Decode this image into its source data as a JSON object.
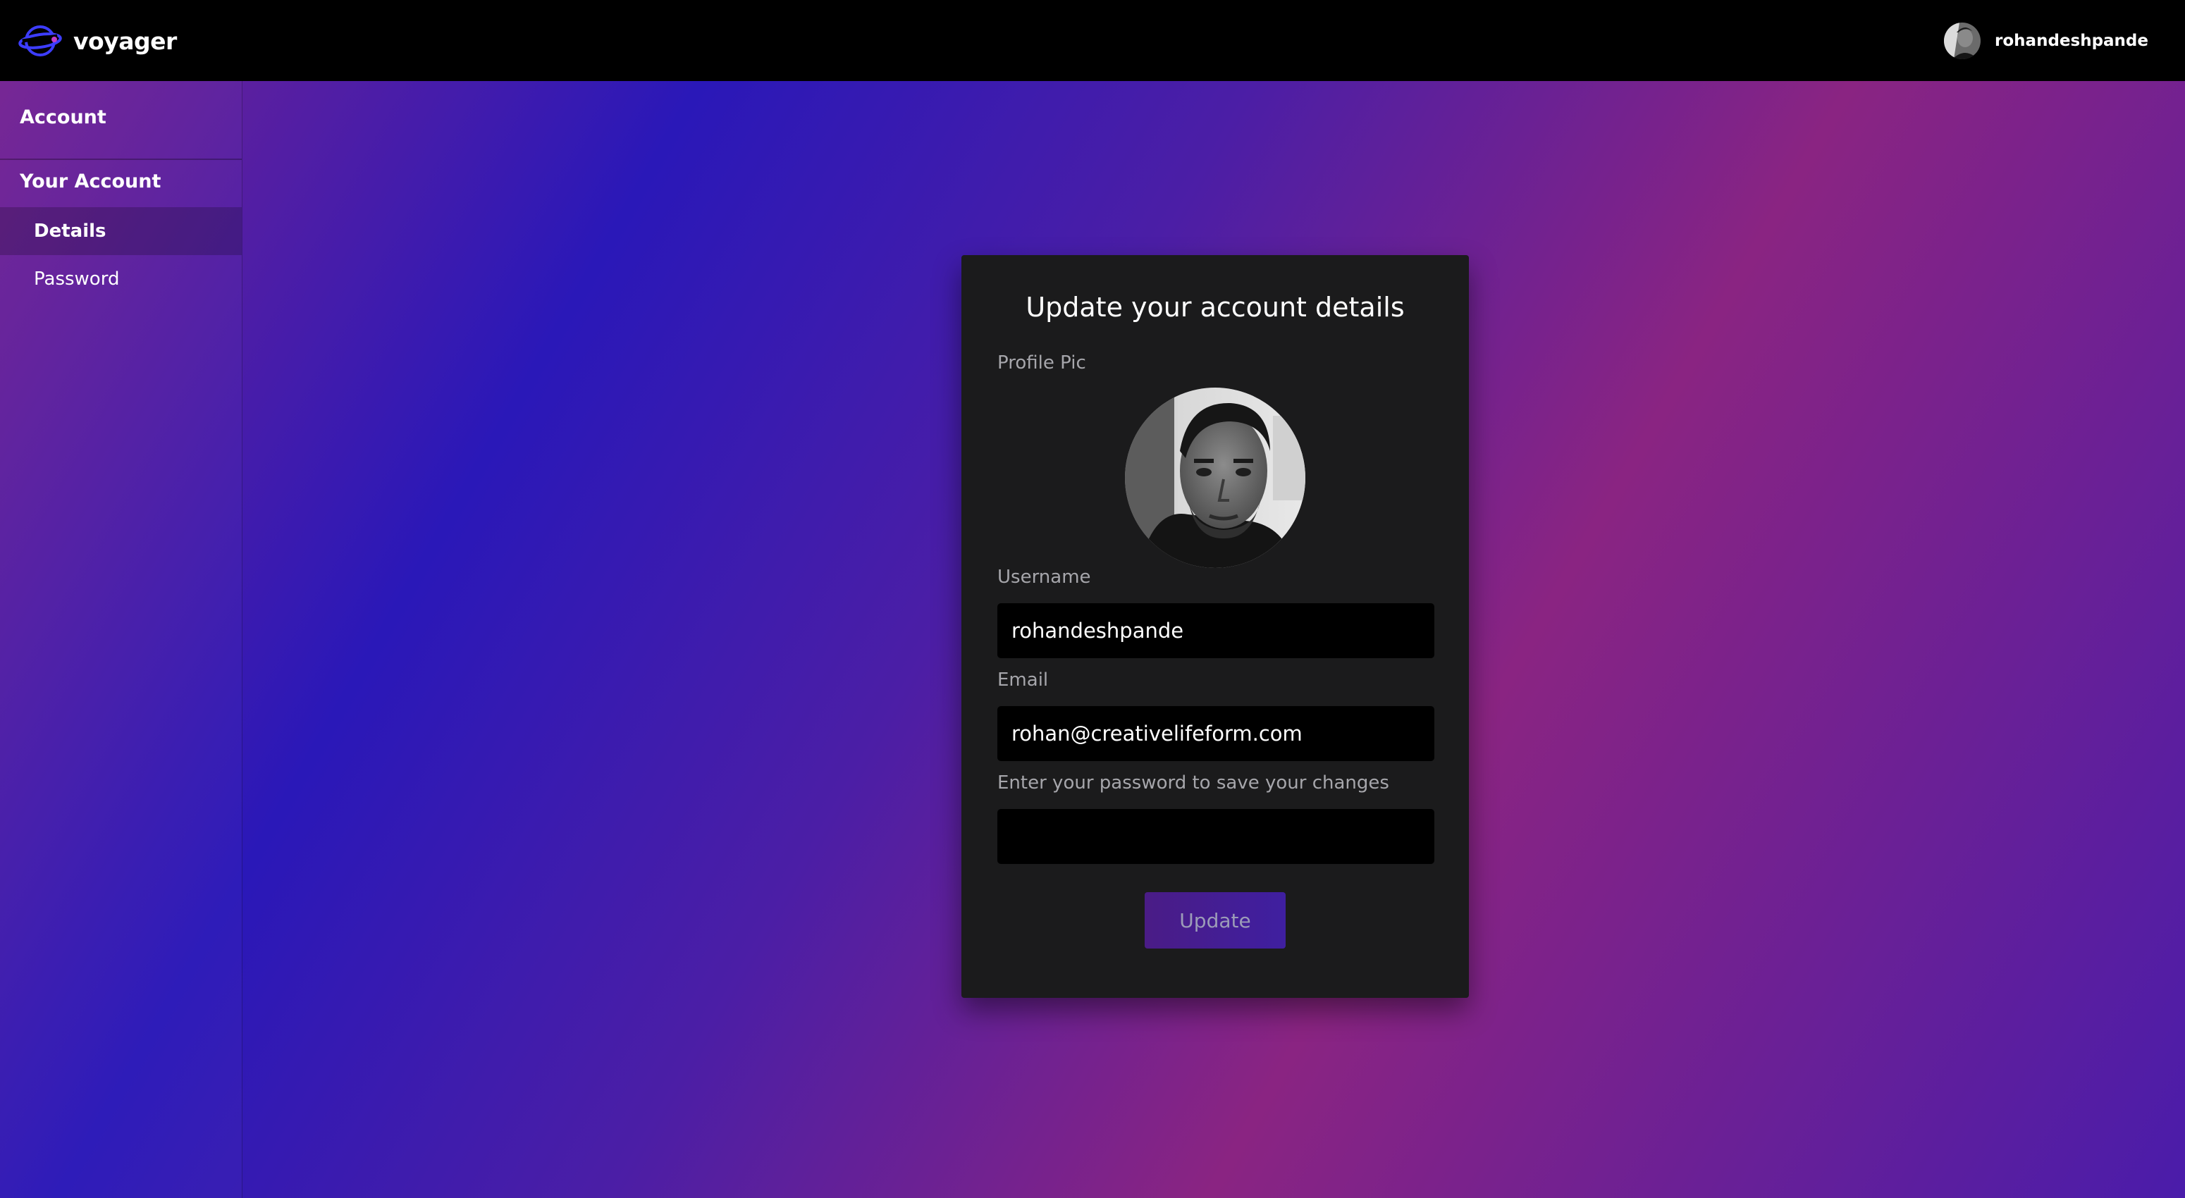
{
  "app": {
    "brand_name": "voyager",
    "brand_icon": "planet-ring-icon"
  },
  "header": {
    "user_name": "rohandeshpande",
    "user_avatar_icon": "user-avatar-photo"
  },
  "sidebar": {
    "heading": "Account",
    "section_title": "Your Account",
    "items": [
      {
        "label": "Details",
        "active": true
      },
      {
        "label": "Password",
        "active": false
      }
    ]
  },
  "form": {
    "title": "Update your account details",
    "profile_pic_label": "Profile Pic",
    "username_label": "Username",
    "username_value": "rohandeshpande",
    "email_label": "Email",
    "email_value": "rohan@creativelifeform.com",
    "password_label": "Enter your password to save your changes",
    "password_value": "",
    "submit_label": "Update"
  },
  "colors": {
    "topbar": "#000000",
    "card": "#1b1b1c",
    "input": "#000000",
    "label": "#a6a6ab",
    "brand_accent": "#3b3bff",
    "button": "#4a1c86"
  }
}
